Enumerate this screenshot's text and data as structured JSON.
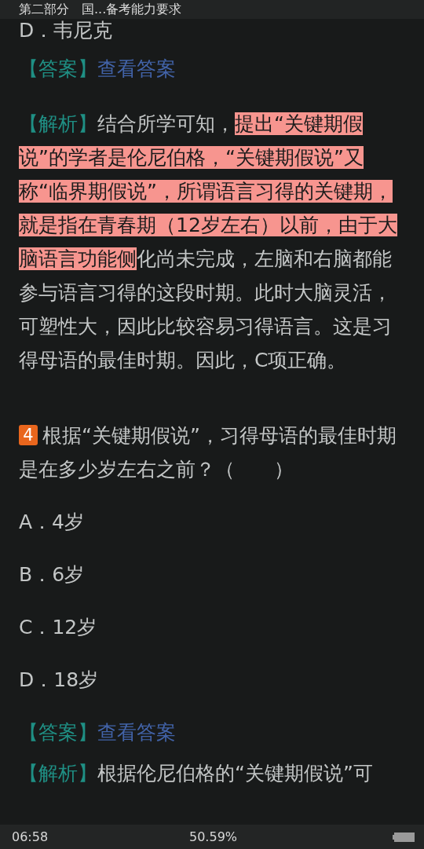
{
  "header": {
    "title": "第二部分　国...备考能力要求"
  },
  "previous_option": "D．韦尼克",
  "previous_answer": {
    "label": "【答案】",
    "link": "查看答案"
  },
  "previous_analysis": {
    "label": "【解析】",
    "segments": [
      {
        "text": "结合所学可知，",
        "highlighted": false
      },
      {
        "text": "提出“关键期假说”的学者是伦尼伯格，“关键期假说”又称“临界期假说”，所谓语言习得的关键期，就是指在青春期（12岁左右）以前，由于大脑语言功能侧",
        "highlighted": true
      },
      {
        "text": "化尚未完成，左脑和右脑都能参与语言习得的这段时期。此时大脑灵活，可塑性大，因此比较容易习得语言。这是习得母语的最佳时期。因此，C项正确。",
        "highlighted": false
      }
    ]
  },
  "question": {
    "number": "4",
    "text": "根据“关键期假说”，习得母语的最佳时期是在多少岁左右之前？（　　）",
    "options": [
      "A．4岁",
      "B．6岁",
      "C．12岁",
      "D．18岁"
    ],
    "answer": {
      "label": "【答案】",
      "link": "查看答案"
    },
    "analysis": {
      "label": "【解析】",
      "text": "根据伦尼伯格的“关键期假说”可"
    }
  },
  "status_bar": {
    "time": "06:58",
    "progress": "50.59%"
  }
}
